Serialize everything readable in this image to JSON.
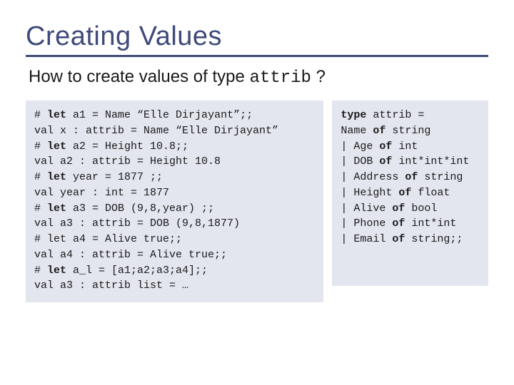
{
  "title": "Creating Values",
  "subtitle_prefix": "How to create values of type ",
  "subtitle_code": "attrib",
  "subtitle_suffix": " ?",
  "left_code": {
    "l1a": "# ",
    "l1b": "let",
    "l1c": " a1 = Name “Elle Dirjayant”;;",
    "l2": "val x : attrib = Name “Elle Dirjayant”",
    "l3a": "# ",
    "l3b": "let",
    "l3c": " a2 = Height 10.8;;",
    "l4": "val a2 : attrib = Height 10.8",
    "l5a": "# ",
    "l5b": "let",
    "l5c": " year = 1877 ;;",
    "l6": "val year : int = 1877",
    "l7a": "# ",
    "l7b": "let",
    "l7c": " a3 = DOB (9,8,year) ;;",
    "l8": "val a3 : attrib = DOB (9,8,1877)",
    "l9": "# let a4 = Alive true;;",
    "l10": "val a4 : attrib = Alive true;;",
    "l11a": "# ",
    "l11b": "let",
    "l11c": " a_l = [a1;a2;a3;a4];;",
    "l12": "val a3 : attrib list = …"
  },
  "right_code": {
    "r1a": "type",
    "r1b": " attrib =",
    "r2a": "  Name ",
    "r2b": "of",
    "r2c": " string",
    "r3a": "| Age ",
    "r3b": "of",
    "r3c": " int",
    "r4a": "| DOB ",
    "r4b": "of",
    "r4c": " int*int*int",
    "r5a": "| Address ",
    "r5b": "of",
    "r5c": " string",
    "r6a": "| Height ",
    "r6b": "of",
    "r6c": " float",
    "r7a": "| Alive ",
    "r7b": "of",
    "r7c": " bool",
    "r8a": "| Phone ",
    "r8b": "of",
    "r8c": " int*int",
    "r9a": "| Email ",
    "r9b": "of",
    "r9c": " string;;"
  }
}
